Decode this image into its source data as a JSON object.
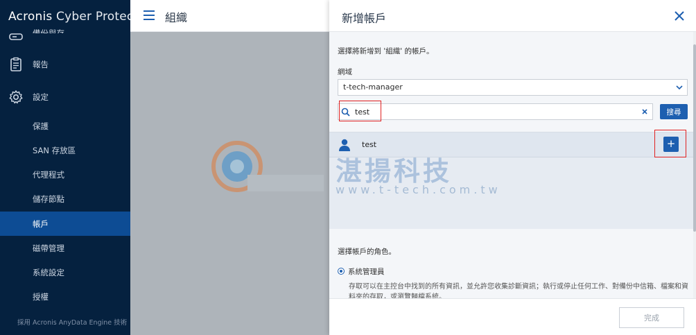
{
  "app": {
    "brand_bold": "Acronis",
    "brand_light": " Cyber Protect"
  },
  "sidebar": {
    "items": [
      {
        "label": "備份與存",
        "icon": "storage-icon"
      },
      {
        "label": "報告",
        "icon": "clipboard-icon"
      },
      {
        "label": "設定",
        "icon": "gear-icon"
      },
      {
        "label": "保護"
      },
      {
        "label": "SAN 存放區"
      },
      {
        "label": "代理程式"
      },
      {
        "label": "儲存節點"
      },
      {
        "label": "帳戶",
        "active": true
      },
      {
        "label": "磁帶管理"
      },
      {
        "label": "系統設定"
      },
      {
        "label": "授權"
      }
    ],
    "footer": "採用 Acronis AnyData Engine 技術"
  },
  "page": {
    "title": "組織"
  },
  "modal": {
    "title": "新增帳戶",
    "intro": "選擇將新增到 '組織' 的帳戶。",
    "domain_label": "網域",
    "domain_value": "t-tech-manager",
    "search_value": "test",
    "search_button": "搜尋",
    "results": [
      {
        "name": "test",
        "add_label": "+"
      }
    ],
    "role_label": "選擇帳戶的角色。",
    "role_name": "系統管理員",
    "role_desc": "存取可以在主控台中找到的所有資訊，並允許您收集診斷資訊；執行或停止任何工作、對備份中信箱、檔案和資料夾的存取，或瀏覽歸檔系統。",
    "done_button": "完成"
  },
  "watermark": {
    "brand": "湛揚科技",
    "url": "www.t-tech.com.tw"
  },
  "colors": {
    "sidebar_bg": "#05213f",
    "active_item": "#0d4c94",
    "primary": "#1d5fb0",
    "highlight": "#e02020"
  }
}
